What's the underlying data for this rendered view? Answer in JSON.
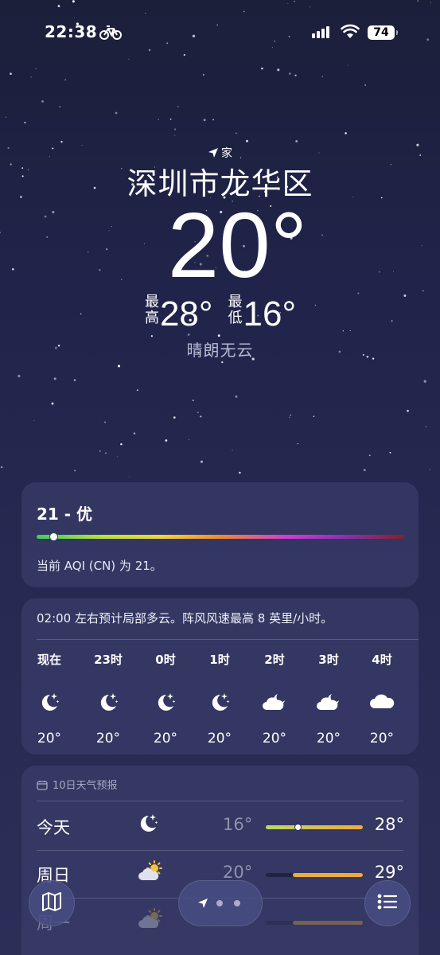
{
  "status_bar": {
    "time": "22:38",
    "activity_icon": "bicycle-icon",
    "signal_icon": "cellular-signal-icon",
    "wifi_icon": "wifi-icon",
    "battery_level": "74"
  },
  "location": {
    "tag_icon": "location-arrow-icon",
    "tag": "家",
    "city": "深圳市龙华区",
    "current_temp": "20°",
    "high_label": "最高",
    "high": "28°",
    "low_label": "最低",
    "low": "16°",
    "condition": "晴朗无云"
  },
  "aqi": {
    "title": "21 - 优",
    "level": 0.045,
    "description": "当前 AQI (CN) 为 21。"
  },
  "hourly": {
    "note": "02:00 左右预计局部多云。阵风风速最高 8 英里/小时。",
    "items": [
      {
        "label": "现在",
        "icon": "moon-stars-icon",
        "temp": "20°"
      },
      {
        "label": "23时",
        "icon": "moon-stars-icon",
        "temp": "20°"
      },
      {
        "label": "0时",
        "icon": "moon-stars-icon",
        "temp": "20°"
      },
      {
        "label": "1时",
        "icon": "moon-stars-icon",
        "temp": "20°"
      },
      {
        "label": "2时",
        "icon": "cloud-moon-icon",
        "temp": "20°"
      },
      {
        "label": "3时",
        "icon": "cloud-moon-icon",
        "temp": "20°"
      },
      {
        "label": "4时",
        "icon": "cloud-icon",
        "temp": "20°"
      }
    ]
  },
  "daily": {
    "header_icon": "calendar-icon",
    "header": "10日天气预报",
    "days": [
      {
        "name": "今天",
        "icon": "moon-stars-icon",
        "low": "16°",
        "high": "28°",
        "range_start": 0.0,
        "range_end": 1.0,
        "current": 0.33
      },
      {
        "name": "周日",
        "icon": "cloud-sun-icon",
        "low": "20°",
        "high": "29°",
        "range_start": 0.28,
        "range_end": 1.0
      },
      {
        "name": "周一",
        "icon": "cloud-sun-icon",
        "low": "",
        "high": "",
        "range_start": 0.28,
        "range_end": 1.0
      }
    ]
  },
  "bottom_bar": {
    "map_icon": "map-icon",
    "location_icon": "location-arrow-icon",
    "list_icon": "list-icon",
    "page_dots": 2
  },
  "colors": {
    "background_top": "#1b1f3a",
    "background_bottom": "#2b2f58",
    "card": "#3e4270",
    "aqi_good": "#3ccf5b",
    "range_warm": "#f2a93a",
    "range_cool": "#b7d96a"
  }
}
